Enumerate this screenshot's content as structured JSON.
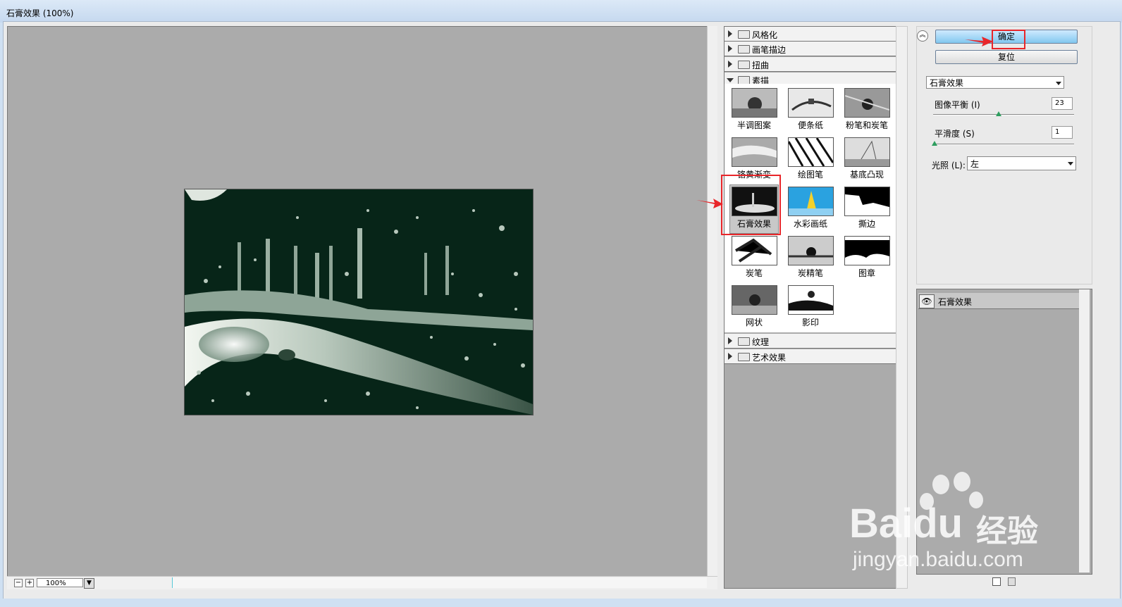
{
  "window": {
    "title": "石膏效果 (100%)"
  },
  "preview": {
    "zoom": "100%",
    "zoom_out": "−",
    "zoom_in": "+"
  },
  "gallery": {
    "categories_top": [
      "风格化",
      "画笔描边",
      "扭曲"
    ],
    "open_category": "素描",
    "thumbs": [
      "半调图案",
      "便条纸",
      "粉笔和炭笔",
      "铬黄渐变",
      "绘图笔",
      "基底凸现",
      "石膏效果",
      "水彩画纸",
      "撕边",
      "炭笔",
      "炭精笔",
      "图章",
      "网状",
      "影印"
    ],
    "categories_bottom": [
      "纹理",
      "艺术效果"
    ]
  },
  "buttons": {
    "ok": "确定",
    "reset": "复位"
  },
  "filter_select": "石膏效果",
  "params": {
    "image_balance_label": "图像平衡 (I)",
    "image_balance_value": "23",
    "smoothness_label": "平滑度 (S)",
    "smoothness_value": "1",
    "light_label": "光照 (L):",
    "light_value": "左"
  },
  "layers": {
    "item": "石膏效果",
    "eye_icon_glyph": "👁"
  },
  "watermark": {
    "brand": "Baidu",
    "suffix": "经验",
    "url": "jingyan.baidu.com"
  },
  "colors": {
    "accent_red": "#e8262a",
    "ok_button": "#82c7ef",
    "plaster_bg": "#072518"
  }
}
